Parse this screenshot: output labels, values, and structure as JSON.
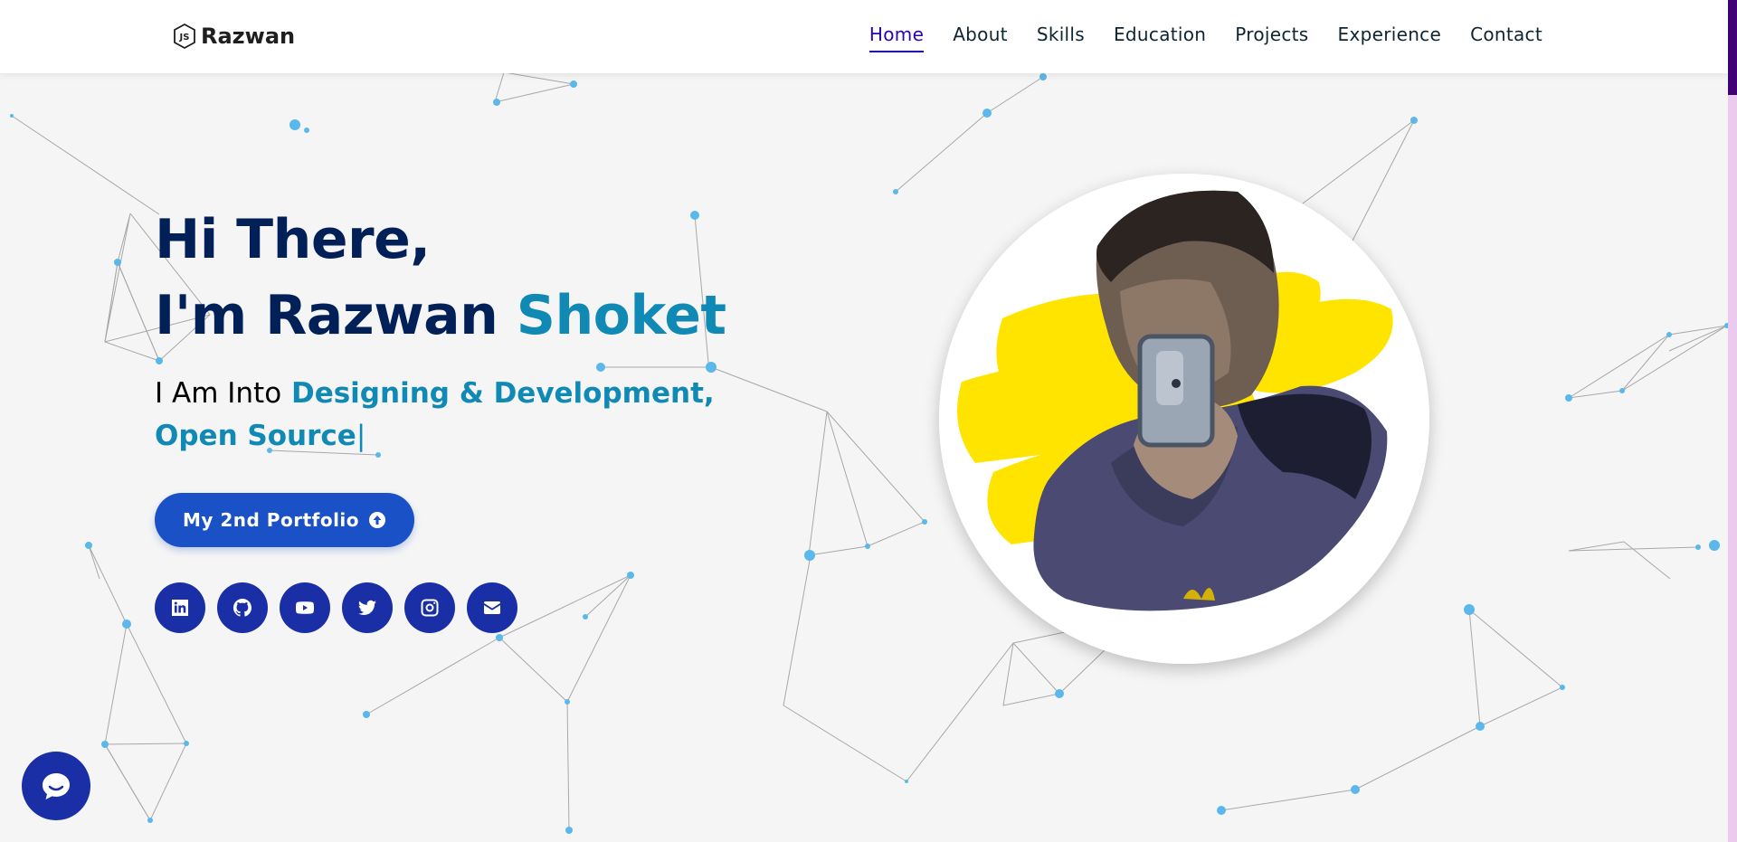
{
  "brand": {
    "name": "Razwan",
    "icon": "js-hexagon-icon"
  },
  "nav": {
    "items": [
      {
        "label": "Home",
        "active": true
      },
      {
        "label": "About"
      },
      {
        "label": "Skills"
      },
      {
        "label": "Education"
      },
      {
        "label": "Projects"
      },
      {
        "label": "Experience"
      },
      {
        "label": "Contact"
      }
    ]
  },
  "hero": {
    "greeting": "Hi There,",
    "name_prefix": "I'm Razwan",
    "name_highlight": "Shoket",
    "typed_lead": "I Am Into",
    "typed_roles": "Designing & Development, Open Source",
    "cursor": "|",
    "cta_label": "My 2nd Portfolio",
    "cta_icon": "arrow-circle-up-icon"
  },
  "socials": [
    {
      "name": "linkedin-icon"
    },
    {
      "name": "github-icon"
    },
    {
      "name": "youtube-icon"
    },
    {
      "name": "twitter-icon"
    },
    {
      "name": "instagram-icon"
    },
    {
      "name": "envelope-icon"
    }
  ],
  "colors": {
    "navy": "#002057",
    "teal_accent": "#1089b4",
    "button_blue": "#1a51c7",
    "social_blue": "#1a2fa6",
    "nav_active": "#2506ad",
    "particle": "#5ab9ea",
    "scroll_thumb": "#420177",
    "scroll_track": "#ecc9ee"
  },
  "chat_widget": {
    "icon": "chat-bubble-icon"
  }
}
